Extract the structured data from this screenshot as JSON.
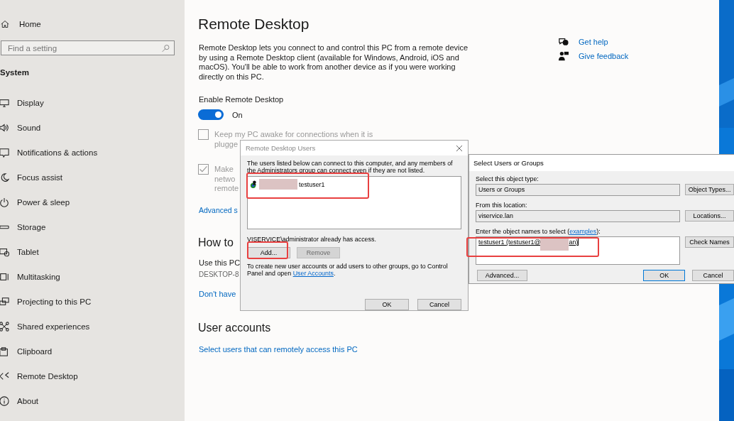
{
  "sidebar": {
    "home": "Home",
    "search": {
      "placeholder": "Find a setting"
    },
    "section": "System",
    "items": [
      {
        "label": "Display"
      },
      {
        "label": "Sound"
      },
      {
        "label": "Notifications & actions"
      },
      {
        "label": "Focus assist"
      },
      {
        "label": "Power & sleep"
      },
      {
        "label": "Storage"
      },
      {
        "label": "Tablet"
      },
      {
        "label": "Multitasking"
      },
      {
        "label": "Projecting to this PC"
      },
      {
        "label": "Shared experiences"
      },
      {
        "label": "Clipboard"
      },
      {
        "label": "Remote Desktop"
      },
      {
        "label": "About"
      }
    ]
  },
  "page": {
    "title": "Remote Desktop",
    "description": "Remote Desktop lets you connect to and control this PC from a remote device by using a Remote Desktop client (available for Windows, Android, iOS and macOS). You'll be able to work from another device as if you were working directly on this PC.",
    "enable_label": "Enable Remote Desktop",
    "toggle": {
      "on": true,
      "label": "On"
    },
    "checkboxes": [
      {
        "lines": [
          "Keep my PC awake for connections when it is",
          "plugge"
        ],
        "checked": false
      },
      {
        "lines": [
          "Make",
          "netwo",
          "remote"
        ],
        "checked": true
      }
    ],
    "advanced_link": "Advanced s",
    "how_heading": "How to",
    "use_text": "Use this PC",
    "pc_name": "DESKTOP-8",
    "dont_have_link": "Don't have",
    "accounts_heading": "User accounts",
    "accounts_link": "Select users that can remotely access this PC"
  },
  "help": [
    {
      "label": "Get help"
    },
    {
      "label": "Give feedback"
    }
  ],
  "rd_users_dialog": {
    "title": "Remote Desktop Users",
    "intro": "The users listed below can connect to this computer, and any members of the Administrators group can connect even if they are not listed.",
    "users": [
      "testuser1"
    ],
    "access_note": "VISERVICE\\administrator already has access.",
    "buttons": [
      {
        "label": "Add...",
        "disabled": false
      },
      {
        "label": "Remove",
        "disabled": true
      }
    ],
    "footer_text": "To create new user accounts or add users to other groups, go to Control Panel and open",
    "footer_link": "User Accounts",
    "footer_end": ".",
    "footer_buttons": [
      {
        "label": "OK"
      },
      {
        "label": "Cancel"
      }
    ]
  },
  "select_dialog": {
    "title": "Select Users or Groups",
    "type_label": "Select this object type:",
    "type_value": "Users or Groups",
    "type_button": "Object Types...",
    "location_label": "From this location:",
    "location_value": "viservice.lan",
    "location_button": "Locations...",
    "names_label": "Enter the object names to select (",
    "names_link": "examples",
    "names_label_end": "):",
    "names_value_start": "testuser1 (testuser1@",
    "names_value_end": "an)",
    "check_button": "Check Names",
    "advanced_button": "Advanced...",
    "footer_buttons": [
      {
        "label": "OK",
        "default": true
      },
      {
        "label": "Cancel",
        "default": false
      }
    ]
  }
}
